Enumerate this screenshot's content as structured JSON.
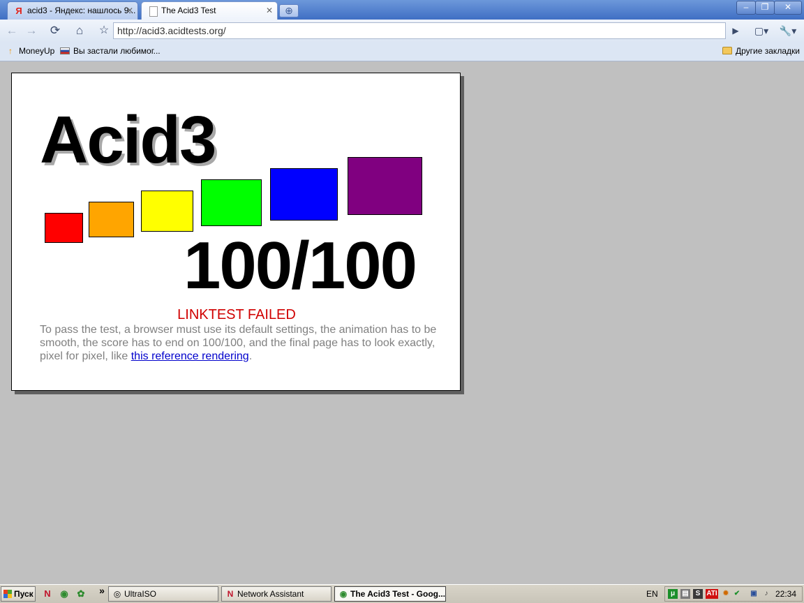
{
  "tabs": [
    {
      "title": "acid3 - Яндекс: нашлось 9...",
      "icon": "yandex-icon",
      "favicon_text": "Я"
    },
    {
      "title": "The Acid3 Test",
      "icon": "page-icon"
    }
  ],
  "window_controls": {
    "minimize": "–",
    "maximize": "❐",
    "close": "✕"
  },
  "toolbar": {
    "url": "http://acid3.acidtests.org/",
    "icons": {
      "back": "←",
      "forward": "→",
      "reload": "⟳",
      "home": "⌂",
      "star": "☆",
      "go": "▶",
      "page_menu": "▢▾",
      "wrench_menu": "🔧▾"
    }
  },
  "bookmarks": [
    {
      "label": "MoneyUp",
      "icon": "up-arrow-icon"
    },
    {
      "label": "Вы застали любимог...",
      "icon": "flag-icon"
    }
  ],
  "other_bookmarks": {
    "label": "Другие закладки",
    "icon": "folder-icon"
  },
  "acid3": {
    "title": "Acid3",
    "score": "100/100",
    "status": "LINKTEST FAILED",
    "instructions_text": "To pass the test, a browser must use its default settings, the animation has to be smooth, the score has to end on 100/100, and the final page has to look exactly, pixel for pixel, like ",
    "link_text": "this reference rendering",
    "instructions_end": ".",
    "box_colors": [
      "#ff0000",
      "#ffa500",
      "#ffff00",
      "#00ff00",
      "#0000ff",
      "#800080"
    ]
  },
  "taskbar": {
    "start_label": "Пуск",
    "chevron": "»",
    "tasks": [
      {
        "label": "UltraISO",
        "active": false
      },
      {
        "label": "Network Assistant",
        "active": false
      },
      {
        "label": "The Acid3 Test - Goog...",
        "active": true
      }
    ],
    "language": "EN",
    "clock": "22:34"
  }
}
